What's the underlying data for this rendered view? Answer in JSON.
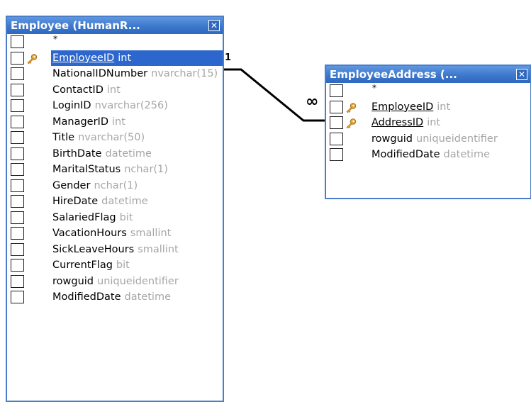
{
  "relationship": {
    "one_label": "1",
    "many_label": "∞"
  },
  "employee_table": {
    "title": "Employee (HumanR...",
    "close_glyph": "✕",
    "rows": [
      {
        "name": "*",
        "type": ""
      },
      {
        "name": "EmployeeID",
        "type": "int",
        "key": true,
        "selected": true
      },
      {
        "name": "NationalIDNumber",
        "type": "nvarchar(15)"
      },
      {
        "name": "ContactID",
        "type": "int"
      },
      {
        "name": "LoginID",
        "type": "nvarchar(256)"
      },
      {
        "name": "ManagerID",
        "type": "int"
      },
      {
        "name": "Title",
        "type": "nvarchar(50)"
      },
      {
        "name": "BirthDate",
        "type": "datetime"
      },
      {
        "name": "MaritalStatus",
        "type": "nchar(1)"
      },
      {
        "name": "Gender",
        "type": "nchar(1)"
      },
      {
        "name": "HireDate",
        "type": "datetime"
      },
      {
        "name": "SalariedFlag",
        "type": "bit"
      },
      {
        "name": "VacationHours",
        "type": "smallint"
      },
      {
        "name": "SickLeaveHours",
        "type": "smallint"
      },
      {
        "name": "CurrentFlag",
        "type": "bit"
      },
      {
        "name": "rowguid",
        "type": "uniqueidentifier"
      },
      {
        "name": "ModifiedDate",
        "type": "datetime"
      }
    ]
  },
  "address_table": {
    "title": "EmployeeAddress (...",
    "close_glyph": "✕",
    "rows": [
      {
        "name": "*",
        "type": ""
      },
      {
        "name": "EmployeeID",
        "type": "int",
        "key": true
      },
      {
        "name": "AddressID",
        "type": "int",
        "key": true
      },
      {
        "name": "rowguid",
        "type": "uniqueidentifier"
      },
      {
        "name": "ModifiedDate",
        "type": "datetime"
      }
    ]
  },
  "colors": {
    "title_bar": "#3d78cc",
    "selection": "#2d66cc",
    "type_text": "#a6a6a6",
    "key_icon": "#e8a53a"
  },
  "icons": {
    "key": "key-icon",
    "close": "close-icon"
  }
}
